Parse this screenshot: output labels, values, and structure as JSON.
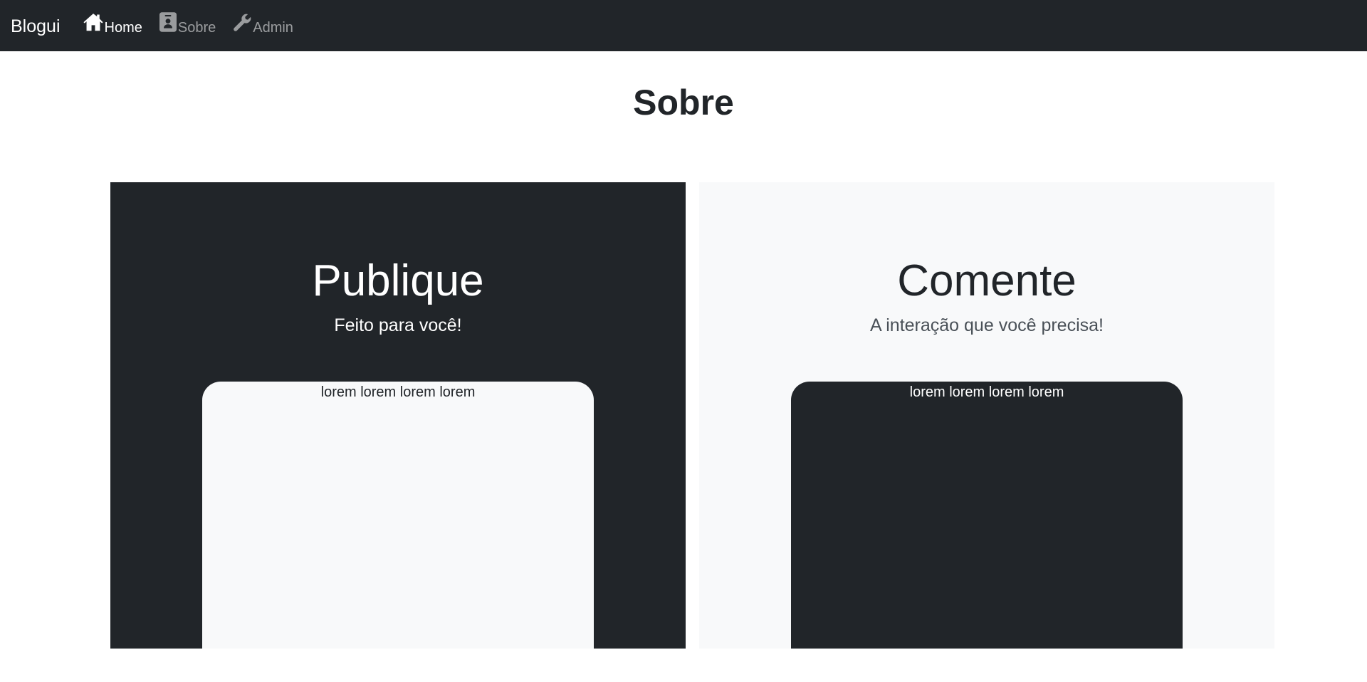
{
  "navbar": {
    "brand": "Blogui",
    "links": [
      {
        "label": "Home",
        "icon": "home-icon",
        "active": true
      },
      {
        "label": "Sobre",
        "icon": "contact-card-icon",
        "active": false
      },
      {
        "label": "Admin",
        "icon": "wrench-icon",
        "active": false
      }
    ]
  },
  "page": {
    "title": "Sobre"
  },
  "panels": [
    {
      "heading": "Publique",
      "subtitle": "Feito para você!",
      "card_text": "lorem lorem lorem lorem",
      "background": "#212529",
      "card_background": "#f8f9fa"
    },
    {
      "heading": "Comente",
      "subtitle": "A interação que você precisa!",
      "card_text": "lorem lorem lorem lorem",
      "background": "#f8f9fa",
      "card_background": "#212529"
    }
  ],
  "colors": {
    "dark": "#212529",
    "light": "#f8f9fa",
    "nav_inactive": "rgba(255,255,255,0.55)"
  }
}
